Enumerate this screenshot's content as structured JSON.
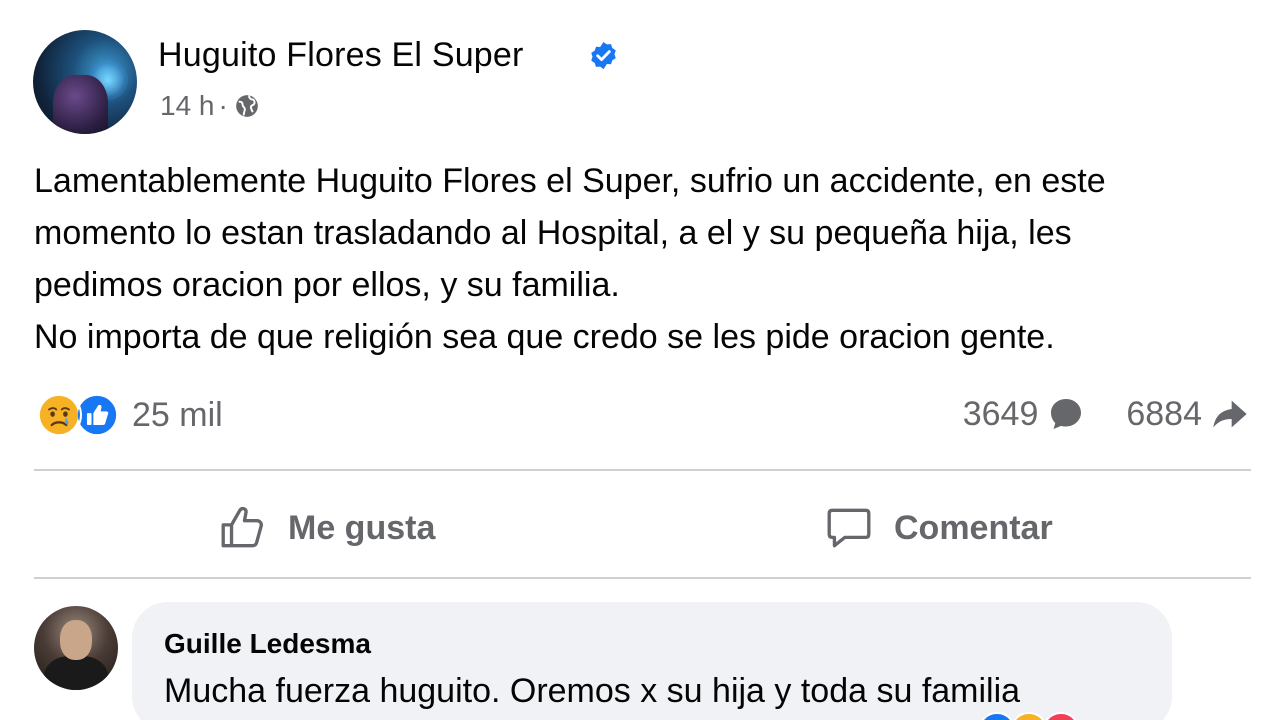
{
  "post": {
    "author": "Huguito Flores El Super",
    "time": "14 h",
    "separator": "·",
    "audience_icon": "globe-icon",
    "verified_icon": "verified-badge-icon",
    "text_lines": [
      "Lamentablemente Huguito Flores el Super, sufrio un accidente, en este",
      "momento lo estan trasladando al Hospital, a el y su pequeña hija, les",
      "pedimos oracion por ellos, y su familia.",
      "No importa de que religión sea que credo se les pide oracion gente."
    ],
    "reactions": {
      "icons": [
        "sad-icon",
        "like-icon"
      ],
      "count": "25 mil"
    },
    "comments_count": "3649",
    "shares_count": "6884",
    "actions": {
      "like_label": "Me gusta",
      "comment_label": "Comentar"
    }
  },
  "comment": {
    "author": "Guille Ledesma",
    "text": "Mucha fuerza huguito. Oremos x su hija y toda su familia"
  },
  "colors": {
    "accent_blue": "#1877f2",
    "secondary_text": "#65676b",
    "divider": "#ced0d4",
    "comment_bg": "#f0f2f5",
    "sad_yellow": "#f7b125"
  }
}
